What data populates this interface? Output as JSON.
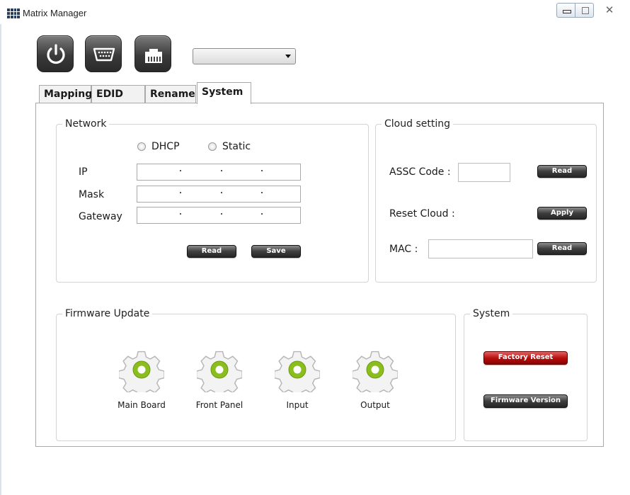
{
  "window": {
    "title": "Matrix Manager"
  },
  "toolbar": {
    "icons": [
      "power-icon",
      "serial-port-icon",
      "ethernet-icon"
    ],
    "device_select": {
      "value": ""
    }
  },
  "tabs": [
    "Mapping",
    "EDID",
    "Rename",
    "System"
  ],
  "active_tab": "System",
  "network": {
    "legend": "Network",
    "radio_dhcp": "DHCP",
    "radio_static": "Static",
    "ip_label": "IP",
    "mask_label": "Mask",
    "gateway_label": "Gateway",
    "read_label": "Read",
    "save_label": "Save"
  },
  "cloud": {
    "legend": "Cloud setting",
    "assc_label": "ASSC Code :",
    "assc_read": "Read",
    "reset_label": "Reset Cloud :",
    "reset_apply": "Apply",
    "mac_label": "MAC :",
    "mac_read": "Read"
  },
  "firmware": {
    "legend": "Firmware Update",
    "items": [
      "Main Board",
      "Front Panel",
      "Input",
      "Output"
    ]
  },
  "system": {
    "legend": "System",
    "factory_reset": "Factory Reset",
    "firmware_version": "Firmware Version"
  },
  "colors": {
    "accent_green": "#8bbd1e",
    "danger_red": "#b81010"
  }
}
